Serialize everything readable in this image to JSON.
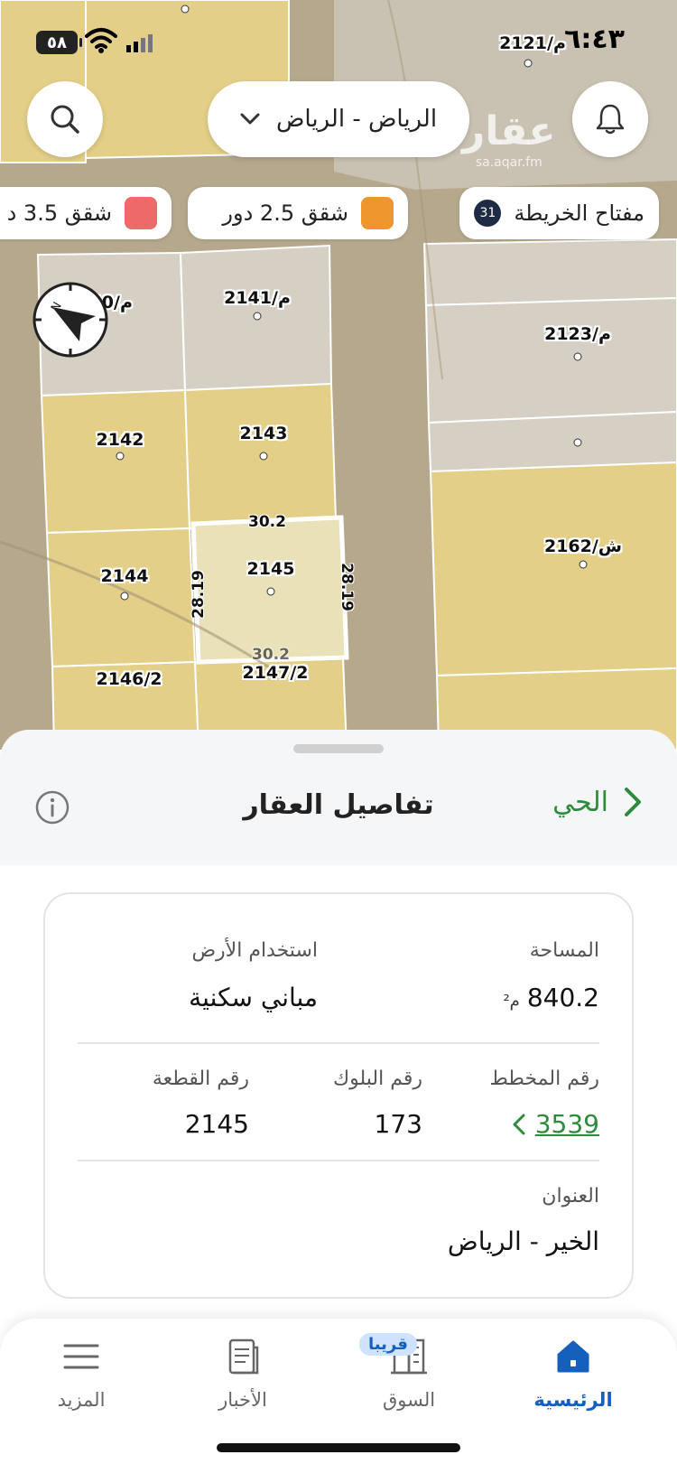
{
  "status_bar": {
    "time": "٦:٤٣",
    "battery": "٥٨"
  },
  "top_bar": {
    "city_select": "الرياض - الرياض",
    "watermark_name": "عقار",
    "watermark_url": "sa.aqar.fm"
  },
  "chips": [
    {
      "label": "مفتاح الخريطة",
      "count": "31"
    },
    {
      "label": "شقق 2.5 دور",
      "color": "#f0962e"
    },
    {
      "label": "شقق 3.5 د",
      "color": "#ee6a6a"
    }
  ],
  "map": {
    "plots": [
      "2121/م",
      "2140/م",
      "2141/م",
      "2123/م",
      "2142",
      "2143",
      "2162/ش",
      "2144",
      "2145",
      "2146/2",
      "2147/2"
    ],
    "dims": [
      "30.2",
      "28.19",
      "28.19",
      "30.2"
    ],
    "colors": {
      "land_yellow": "#e6d28c",
      "land_grey": "#d9d3c6",
      "road": "#b5a88c"
    }
  },
  "sheet": {
    "title": "تفاصيل العقار",
    "back_label": "الحي",
    "area_label": "المساحة",
    "area_value": "840.2",
    "area_unit": "م²",
    "land_use_label": "استخدام الأرض",
    "land_use_value": "مباني سكنية",
    "plan_label": "رقم المخطط",
    "plan_value": "3539",
    "block_label": "رقم البلوك",
    "block_value": "173",
    "plot_label": "رقم القطعة",
    "plot_value": "2145",
    "address_label": "العنوان",
    "address_value": "الخير - الرياض"
  },
  "tabs": [
    {
      "label": "الرئيسية",
      "icon": "home-icon"
    },
    {
      "label": "السوق",
      "icon": "buildings-icon",
      "badge": "قريبا"
    },
    {
      "label": "الأخبار",
      "icon": "news-icon"
    },
    {
      "label": "المزيد",
      "icon": "menu-icon"
    }
  ],
  "accent_colors": {
    "green": "#2e8b3d",
    "blue": "#1560bd"
  }
}
